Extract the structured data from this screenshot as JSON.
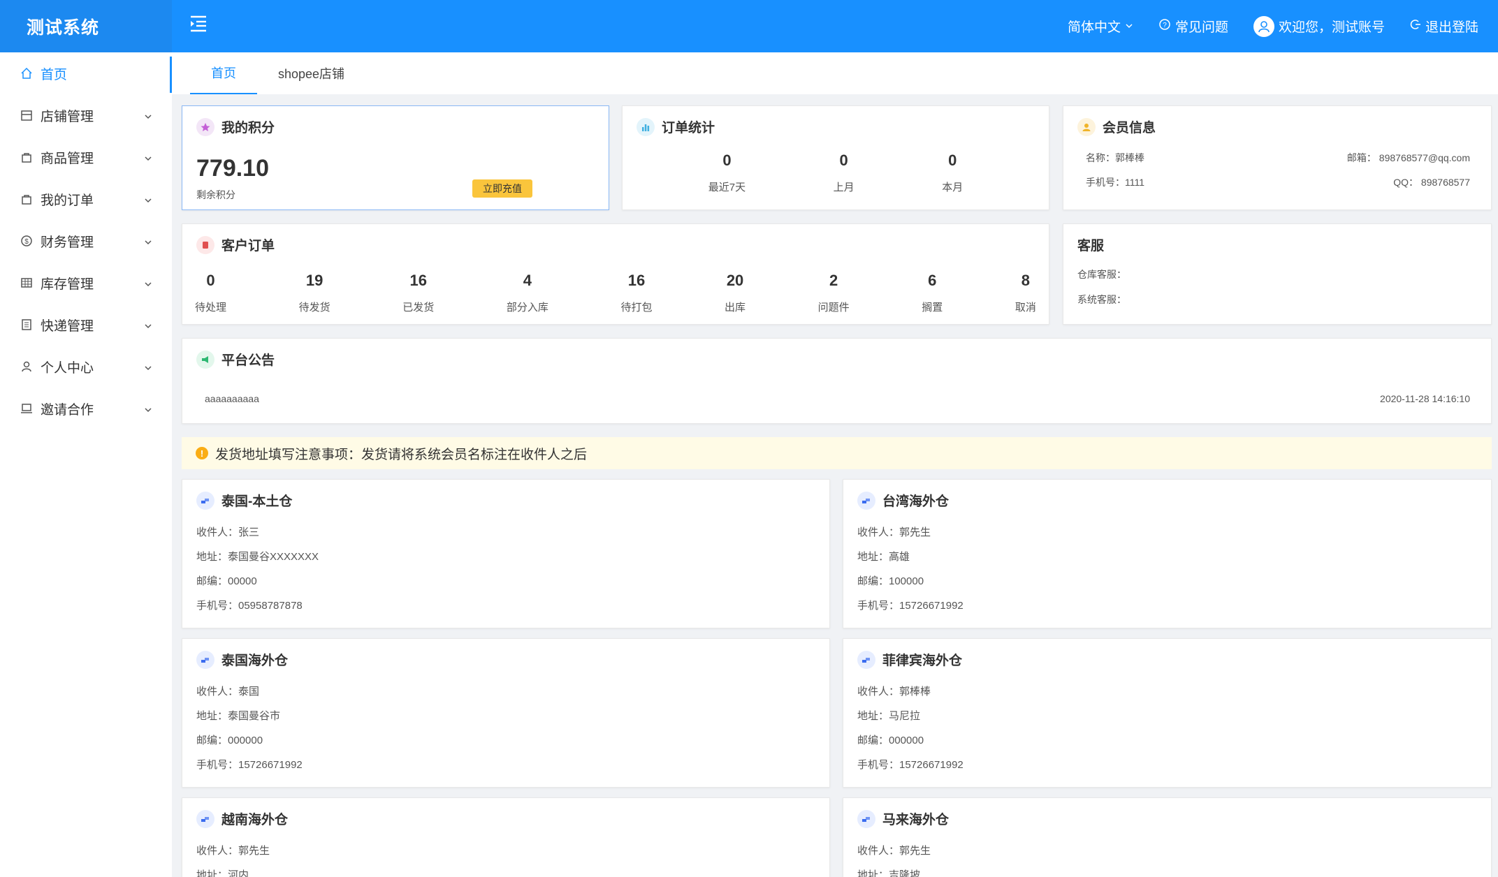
{
  "app": {
    "logo": "测试系统"
  },
  "header": {
    "language": "简体中文",
    "faq": "常见问题",
    "welcome": "欢迎您，测试账号",
    "logout": "退出登陆"
  },
  "sidebar": {
    "items": [
      {
        "label": "首页"
      },
      {
        "label": "店铺管理"
      },
      {
        "label": "商品管理"
      },
      {
        "label": "我的订单"
      },
      {
        "label": "财务管理"
      },
      {
        "label": "库存管理"
      },
      {
        "label": "快递管理"
      },
      {
        "label": "个人中心"
      },
      {
        "label": "邀请合作"
      }
    ]
  },
  "tabs": [
    {
      "label": "首页"
    },
    {
      "label": "shopee店铺"
    }
  ],
  "points": {
    "title": "我的积分",
    "value": "779.10",
    "label": "剩余积分",
    "charge_button": "立即充值"
  },
  "order_stats": {
    "title": "订单统计",
    "items": [
      {
        "value": "0",
        "label": "最近7天"
      },
      {
        "value": "0",
        "label": "上月"
      },
      {
        "value": "0",
        "label": "本月"
      }
    ]
  },
  "member": {
    "title": "会员信息",
    "name": "名称：郭棒棒",
    "email": "邮箱：  898768577@qq.com",
    "phone": "手机号：1111",
    "qq": "QQ：  898768577"
  },
  "customer_orders": {
    "title": "客户订单",
    "items": [
      {
        "value": "0",
        "label": "待处理"
      },
      {
        "value": "19",
        "label": "待发货"
      },
      {
        "value": "16",
        "label": "已发货"
      },
      {
        "value": "4",
        "label": "部分入库"
      },
      {
        "value": "16",
        "label": "待打包"
      },
      {
        "value": "20",
        "label": "出库"
      },
      {
        "value": "2",
        "label": "问题件"
      },
      {
        "value": "6",
        "label": "搁置"
      },
      {
        "value": "8",
        "label": "取消"
      }
    ]
  },
  "service": {
    "title": "客服",
    "warehouse": "仓库客服：",
    "system": "系统客服："
  },
  "announcement": {
    "title": "平台公告",
    "text": "aaaaaaaaaa",
    "time": "2020-11-28 14:16:10"
  },
  "notice": {
    "text": "发货地址填写注意事项：发货请将系统会员名标注在收件人之后"
  },
  "warehouses": [
    {
      "title": "泰国-本土仓",
      "receiver": "收件人：张三",
      "address": "地址：泰国曼谷XXXXXXX",
      "zip": "邮编：00000",
      "phone": "手机号：05958787878"
    },
    {
      "title": "台湾海外仓",
      "receiver": "收件人：郭先生",
      "address": "地址：高雄",
      "zip": "邮编：100000",
      "phone": "手机号：15726671992"
    },
    {
      "title": "泰国海外仓",
      "receiver": "收件人：泰国",
      "address": "地址：泰国曼谷市",
      "zip": "邮编：000000",
      "phone": "手机号：15726671992"
    },
    {
      "title": "菲律宾海外仓",
      "receiver": "收件人：郭棒棒",
      "address": "地址：马尼拉",
      "zip": "邮编：000000",
      "phone": "手机号：15726671992"
    },
    {
      "title": "越南海外仓",
      "receiver": "收件人：郭先生",
      "address": "地址：河内"
    },
    {
      "title": "马来海外仓",
      "receiver": "收件人：郭先生",
      "address": "地址：吉隆坡"
    }
  ],
  "colors": {
    "primary": "#1890ff",
    "charge": "#fac53c",
    "notice_bg": "#fffbe6"
  }
}
